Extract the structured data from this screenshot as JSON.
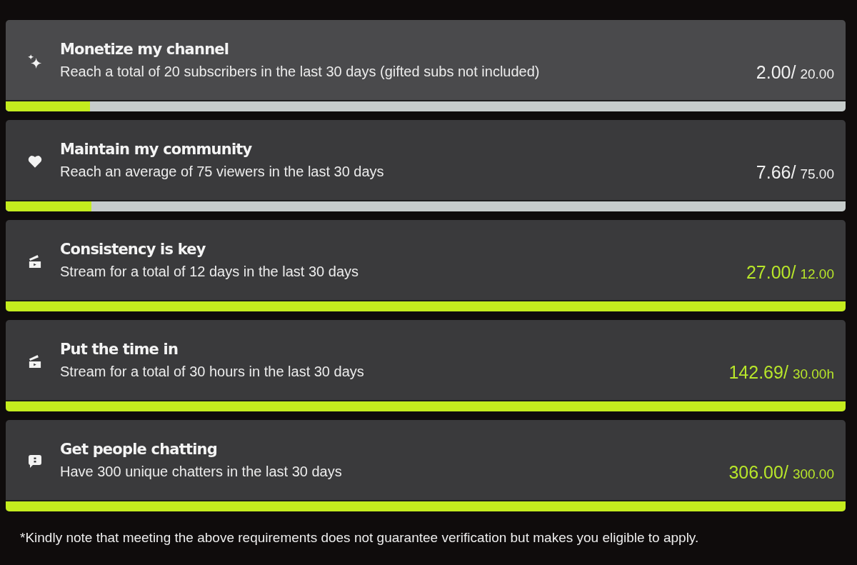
{
  "goals": [
    {
      "kind": "subscribers",
      "title": "Monetize my channel",
      "description": "Reach a total of 20 subscribers in the last 30 days (gifted subs not included)",
      "current": "2.00/",
      "target": "20.00",
      "complete": false,
      "level": 0.1
    },
    {
      "kind": "viewers",
      "title": "Maintain my community",
      "description": "Reach an average of 75 viewers in the last 30 days",
      "current": "7.66/",
      "target": "75.00",
      "complete": false,
      "level": 0.102
    },
    {
      "kind": "stream_days",
      "title": "Consistency is key",
      "description": "Stream for a total of 12 days in the last 30 days",
      "current": "27.00/",
      "target": "12.00",
      "complete": true,
      "level": 1
    },
    {
      "kind": "stream_hours",
      "title": "Put the time in",
      "description": "Stream for a total of 30 hours in the last 30 days",
      "current": "142.69/",
      "target": "30.00h",
      "complete": true,
      "level": 1
    },
    {
      "kind": "chatters",
      "title": "Get people chatting",
      "description": "Have 300 unique chatters in the last 30 days",
      "current": "306.00/",
      "target": "300.00",
      "complete": true,
      "level": 1
    }
  ],
  "footnote": "*Kindly note that meeting the above requirements does not guarantee verification but makes you eligible to apply."
}
